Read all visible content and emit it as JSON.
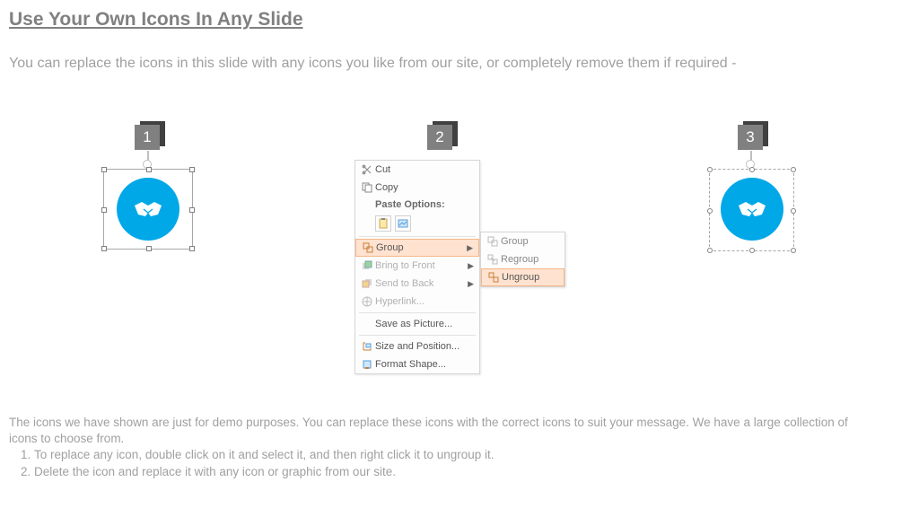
{
  "title": "Use Your Own Icons In Any Slide",
  "subtitle": "You can replace the icons in this slide with any icons you like from our site, or completely remove them if required -",
  "badges": {
    "b1": "1",
    "b2": "2",
    "b3": "3"
  },
  "icon_name": "handshake-icon",
  "contextMenu": {
    "cut": "Cut",
    "copy": "Copy",
    "pasteOptionsHeading": "Paste Options:",
    "group": "Group",
    "bringToFront": "Bring to Front",
    "sendToBack": "Send to Back",
    "hyperlink": "Hyperlink...",
    "saveAsPicture": "Save as Picture...",
    "sizeAndPosition": "Size and Position...",
    "formatShape": "Format Shape..."
  },
  "subMenu": {
    "group": "Group",
    "regroup": "Regroup",
    "ungroup": "Ungroup"
  },
  "footer": {
    "intro": "The icons we have shown are just for demo purposes. You can replace these icons with the correct icons to suit your message. We have a large collection of icons to choose from.",
    "step1": "To replace any icon, double click on it and select it, and then right click it to ungroup it.",
    "step2": "Delete the icon and replace it with any icon or graphic from our site."
  }
}
